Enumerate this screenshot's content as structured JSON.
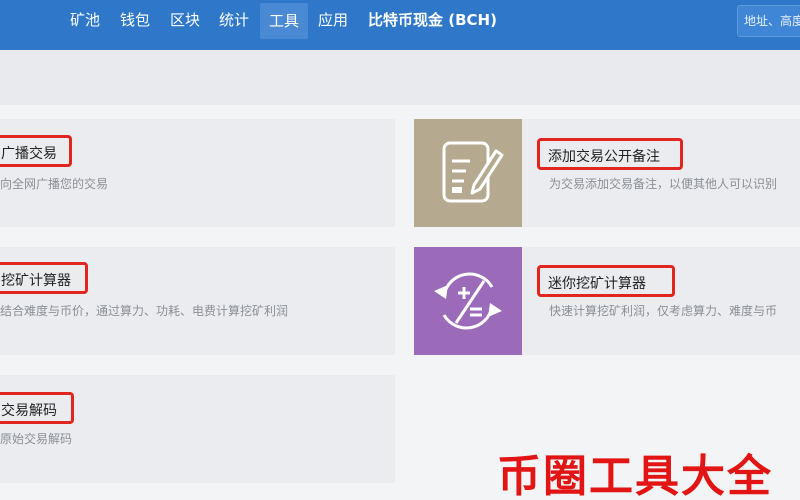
{
  "navbar": {
    "items": [
      {
        "label": "矿池"
      },
      {
        "label": "钱包"
      },
      {
        "label": "区块"
      },
      {
        "label": "统计"
      },
      {
        "label": "工具"
      },
      {
        "label": "应用"
      }
    ],
    "active_item": "工具",
    "brand": "比特币现金 (BCH)",
    "search_placeholder": "地址、高度"
  },
  "cards": [
    {
      "title": "广播交易",
      "desc": "向全网广播您的交易"
    },
    {
      "title": "添加交易公开备注",
      "desc": "为交易添加交易备注，以便其他人可以识别",
      "icon": "note-edit-icon",
      "icon_bg": "#b5aa90"
    },
    {
      "title": "挖矿计算器",
      "desc": "结合难度与币价，通过算力、功耗、电费计算挖矿利润"
    },
    {
      "title": "迷你挖矿计算器",
      "desc": "快速计算挖矿利润，仅考虑算力、难度与币",
      "icon": "calculator-cycle-icon",
      "icon_bg": "#9b6ab8"
    },
    {
      "title": "交易解码",
      "desc": "原始交易解码"
    }
  ],
  "watermark": "币圈工具大全",
  "colors": {
    "navbar": "#2e77c9",
    "highlight": "#e0261f",
    "watermark": "#e21414"
  }
}
